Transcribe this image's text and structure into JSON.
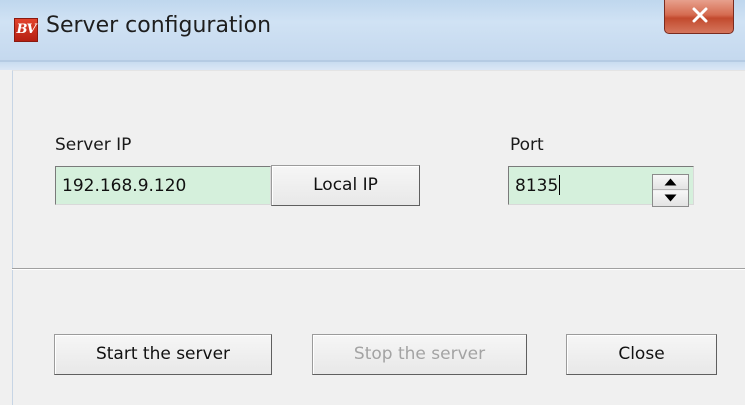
{
  "window": {
    "title": "Server configuration",
    "logo_text": "BV",
    "close_icon": "close-icon"
  },
  "form": {
    "server_ip_label": "Server IP",
    "server_ip_value": "192.168.9.120",
    "local_ip_button": "Local IP",
    "port_label": "Port",
    "port_value": "8135"
  },
  "actions": {
    "start_label": "Start the server",
    "stop_label": "Stop the server",
    "close_label": "Close"
  },
  "colors": {
    "input_background": "#d5f0dc",
    "close_button": "#c24a2e"
  }
}
